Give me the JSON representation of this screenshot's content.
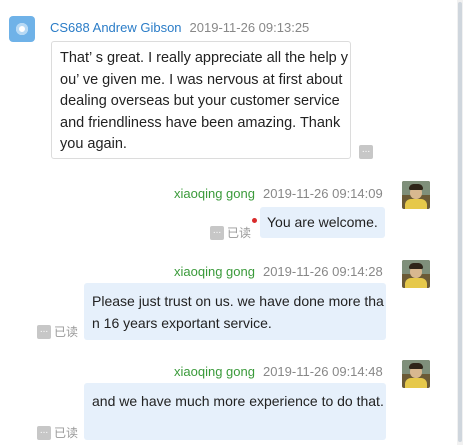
{
  "messages": [
    {
      "sender": "CS688 Andrew Gibson",
      "time": "2019-11-26 09:13:25",
      "text": "That’ s great. I really appreciate all the help you’ ve given me. I was nervous at first  about dealing overseas but your customer service and friendliness have been amazing. Thank you again."
    },
    {
      "sender": "xiaoqing gong",
      "time": "2019-11-26 09:14:09",
      "text": "You are welcome.",
      "status": "已读"
    },
    {
      "sender": "xiaoqing gong",
      "time": "2019-11-26 09:14:28",
      "text": "Please just trust on us. we have done more than 16 years exportant service.",
      "status": "已读"
    },
    {
      "sender": "xiaoqing gong",
      "time": "2019-11-26 09:14:48",
      "text": "and we have much more experience to do that.",
      "status": "已读"
    }
  ],
  "icons": {
    "more": "more-options-icon",
    "unread_marker": "unread-dot-icon"
  },
  "colors": {
    "incoming_sender": "#2a7cc7",
    "outgoing_sender": "#3a9a3a",
    "outgoing_bubble": "#e6f0fb",
    "unread_dot": "#d92b2b"
  }
}
